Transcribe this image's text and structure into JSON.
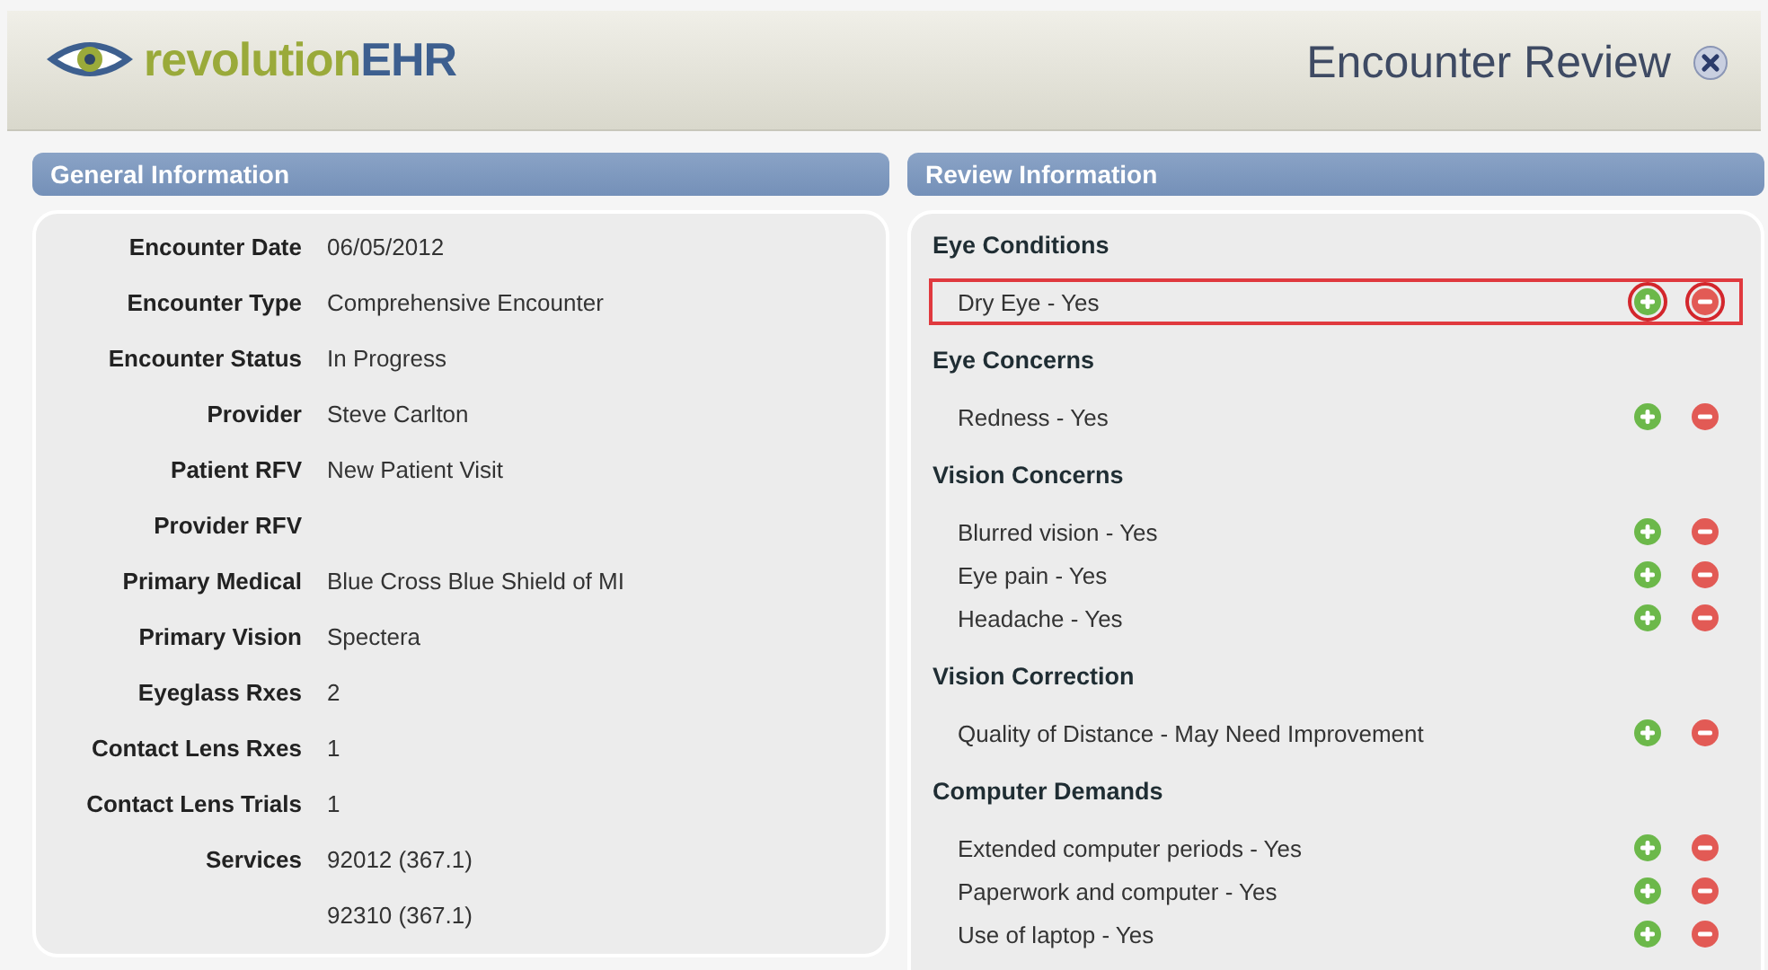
{
  "header": {
    "logo_text": "revolution",
    "logo_emphasis": "EHR",
    "title": "Encounter Review"
  },
  "general": {
    "title": "General Information",
    "fields": [
      {
        "label": "Encounter Date",
        "values": [
          "06/05/2012"
        ]
      },
      {
        "label": "Encounter Type",
        "values": [
          "Comprehensive Encounter"
        ]
      },
      {
        "label": "Encounter Status",
        "values": [
          "In Progress"
        ]
      },
      {
        "label": "Provider",
        "values": [
          "Steve Carlton"
        ]
      },
      {
        "label": "Patient RFV",
        "values": [
          "New Patient Visit"
        ]
      },
      {
        "label": "Provider RFV"
      },
      {
        "label": "Primary Medical",
        "values": [
          "Blue Cross Blue Shield of MI"
        ]
      },
      {
        "label": "Primary Vision",
        "values": [
          "Spectera"
        ]
      },
      {
        "label": "Eyeglass Rxes",
        "values": [
          "2"
        ]
      },
      {
        "label": "Contact Lens Rxes",
        "values": [
          "1"
        ]
      },
      {
        "label": "Contact Lens Trials",
        "values": [
          "1"
        ]
      },
      {
        "label": "Services",
        "values": [
          "92012 (367.1)",
          "92310 (367.1)"
        ]
      }
    ]
  },
  "review": {
    "title": "Review Information",
    "groups": [
      {
        "title": "Eye Conditions",
        "items": [
          {
            "text": "Dry Eye - Yes",
            "highlighted": true
          }
        ]
      },
      {
        "title": "Eye Concerns",
        "items": [
          {
            "text": "Redness - Yes",
            "highlighted": false
          }
        ]
      },
      {
        "title": "Vision Concerns",
        "items": [
          {
            "text": "Blurred vision - Yes",
            "highlighted": false
          },
          {
            "text": "Eye pain - Yes",
            "highlighted": false
          },
          {
            "text": "Headache - Yes",
            "highlighted": false
          }
        ]
      },
      {
        "title": "Vision Correction",
        "items": [
          {
            "text": "Quality of Distance - May Need Improvement",
            "highlighted": false
          }
        ]
      },
      {
        "title": "Computer Demands",
        "items": [
          {
            "text": "Extended computer periods - Yes",
            "highlighted": false
          },
          {
            "text": "Paperwork and computer - Yes",
            "highlighted": false
          },
          {
            "text": "Use of laptop - Yes",
            "highlighted": false
          }
        ]
      }
    ]
  }
}
